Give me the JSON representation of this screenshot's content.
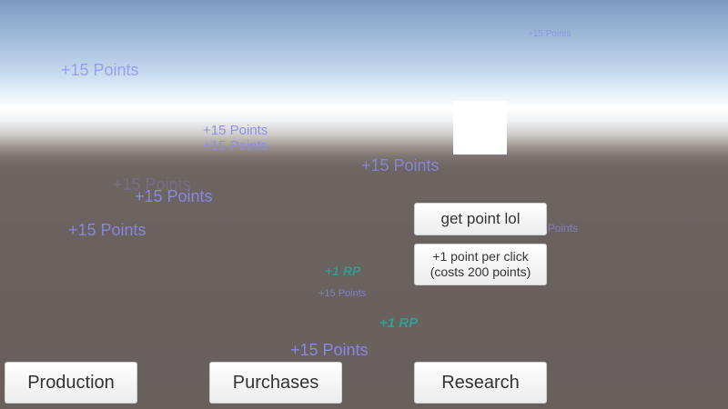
{
  "popups": {
    "points_label": "+15 Points",
    "rp_label": "+1 RP"
  },
  "buttons": {
    "get_point": "get point lol",
    "upgrade_line1": "+1 point per click",
    "upgrade_line2": "(costs 200 points)"
  },
  "tabs": {
    "production": "Production",
    "purchases": "Purchases",
    "research": "Research"
  },
  "colors": {
    "popup_text": "#8c8cf0",
    "rp_text": "#2ea39a"
  }
}
